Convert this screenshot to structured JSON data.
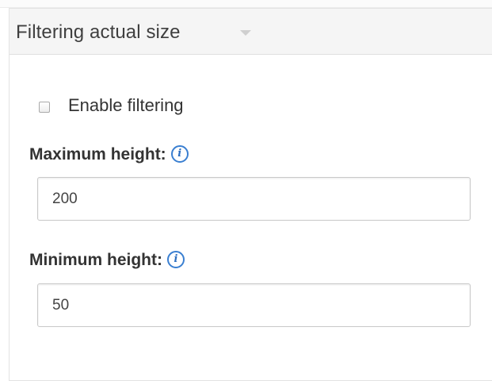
{
  "panel": {
    "title": "Filtering actual size"
  },
  "enable_filtering": {
    "label": "Enable filtering",
    "checked": false
  },
  "maximum_height": {
    "label": "Maximum height:",
    "value": "200"
  },
  "minimum_height": {
    "label": "Minimum height:",
    "value": "50"
  },
  "icons": {
    "caret": "chevron-down-icon",
    "info": "info-icon",
    "info_glyph": "i"
  },
  "colors": {
    "info_accent": "#3a7fd1",
    "header_bg": "#f5f5f5"
  }
}
